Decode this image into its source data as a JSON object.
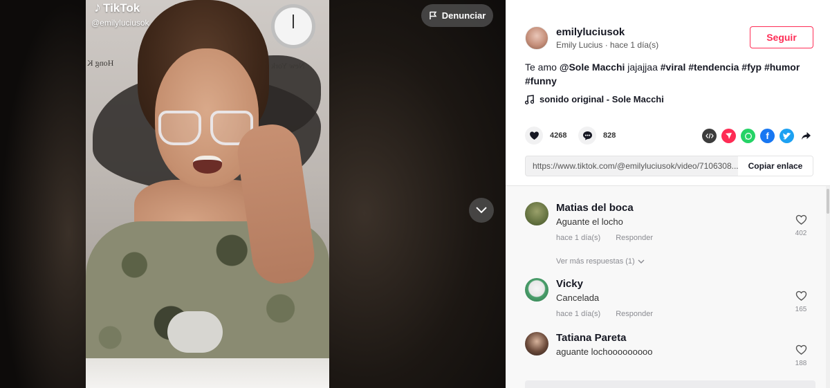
{
  "video": {
    "brand": "TikTok",
    "handle": "@emilyluciusok",
    "report_label": "Denunciar",
    "wall_labels": [
      "Hong K",
      "New York"
    ]
  },
  "author": {
    "username": "emilyluciusok",
    "display_name": "Emily Lucius",
    "separator": "·",
    "time": "hace 1 día(s)",
    "follow_label": "Seguir"
  },
  "caption": {
    "prefix": "Te amo ",
    "mention": "@Sole Macchi",
    "text": " jajajjaa ",
    "hashtags": [
      "#viral",
      "#tendencia",
      "#fyp",
      "#humor",
      "#funny"
    ]
  },
  "sound": "sonido original - Sole Macchi",
  "stats": {
    "likes": "4268",
    "comments": "828"
  },
  "share": {
    "link": "https://www.tiktok.com/@emilyluciusok/video/7106308...",
    "copy_label": "Copiar enlace",
    "icons": [
      "embed-icon",
      "send-icon",
      "whatsapp-icon",
      "facebook-icon",
      "twitter-icon",
      "share-arrow-icon"
    ],
    "colors": {
      "embed": "#3c3c3c",
      "send": "#fe2c55",
      "whatsapp": "#25d366",
      "facebook": "#1877f2",
      "twitter": "#1da1f2"
    }
  },
  "comments": [
    {
      "name": "Matias del boca",
      "text": "Aguante el locho",
      "time": "hace 1 día(s)",
      "reply": "Responder",
      "likes": "402"
    },
    {
      "name": "Vicky",
      "text": "Cancelada",
      "time": "hace 1 día(s)",
      "reply": "Responder",
      "likes": "165"
    },
    {
      "name": "Tatiana Pareta",
      "text": "aguante lochooooooooo",
      "time": "",
      "reply": "",
      "likes": "188"
    }
  ],
  "more_replies": "Ver más respuestas (1)",
  "colors": {
    "accent": "#fe2c55",
    "text": "#161823",
    "muted": "#8a8b91"
  }
}
